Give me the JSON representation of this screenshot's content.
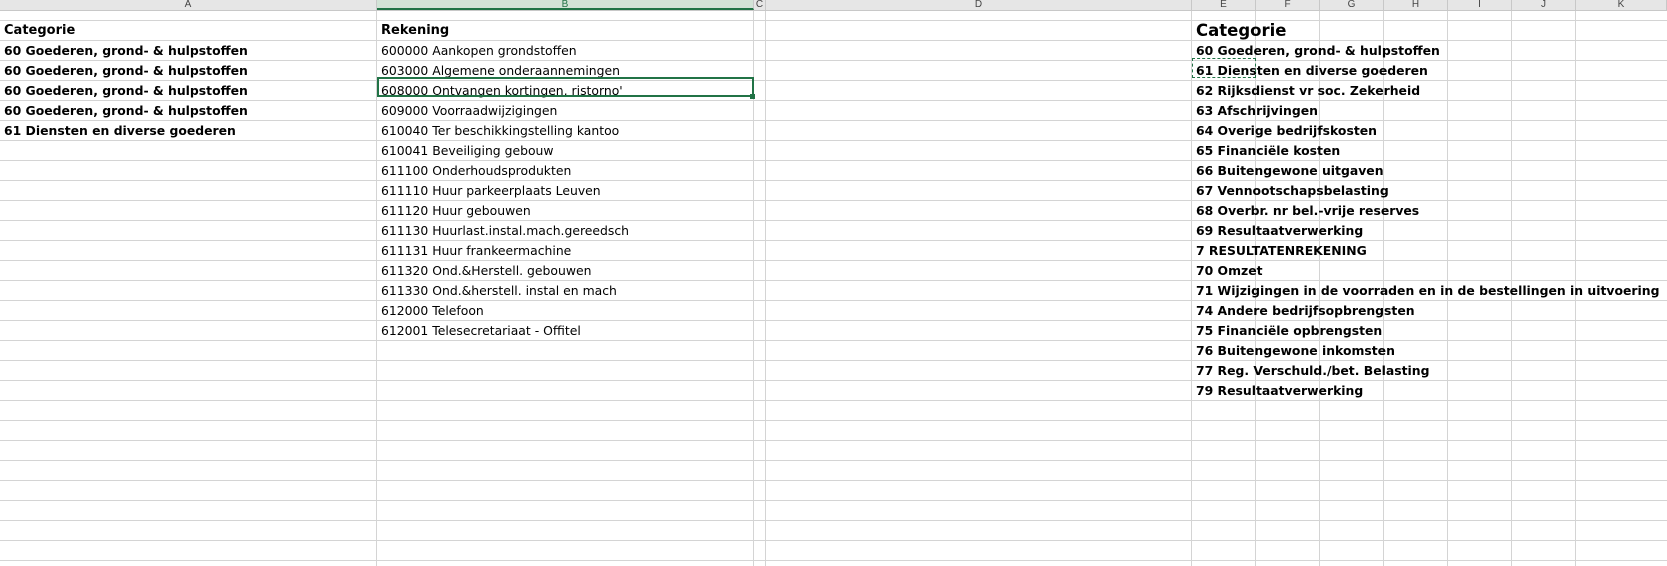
{
  "columns": [
    "A",
    "B",
    "C",
    "D",
    "E",
    "F",
    "G",
    "H",
    "I",
    "J",
    "K"
  ],
  "selected_column": "B",
  "sheet": {
    "a_header": "Categorie",
    "a_rows": [
      "60 Goederen, grond- & hulpstoffen",
      "60 Goederen, grond- & hulpstoffen",
      "60 Goederen, grond- & hulpstoffen",
      "60 Goederen, grond- & hulpstoffen",
      "61 Diensten en diverse goederen"
    ],
    "b_header": "Rekening",
    "b_rows": [
      "600000 Aankopen grondstoffen",
      "603000 Algemene onderaannemingen",
      "608000 Ontvangen kortingen, ristorno'",
      "609000 Voorraadwijzigingen",
      "610040 Ter beschikkingstelling kantoo",
      "610041 Beveiliging gebouw",
      "611100 Onderhoudsprodukten",
      "611110 Huur parkeerplaats Leuven",
      "611120 Huur gebouwen",
      "611130 Huurlast.instal.mach.gereedsch",
      "611131 Huur frankeermachine",
      "611320 Ond.&Herstell. gebouwen",
      "611330 Ond.&herstell. instal en mach",
      "612000 Telefoon",
      "612001 Telesecretariaat - Offitel"
    ],
    "e_header": "Categorie",
    "e_rows": [
      "60 Goederen, grond- & hulpstoffen",
      "61 Diensten en diverse goederen",
      "62 Rijksdienst vr soc. Zekerheid",
      "63 Afschrijvingen",
      "64 Overige bedrijfskosten",
      "65 Financiële kosten",
      "66 Buitengewone uitgaven",
      "67 Vennootschapsbelasting",
      "68 Overbr. nr bel.-vrije reserves",
      "69 Resultaatverwerking",
      "7 RESULTATENREKENING",
      "70 Omzet",
      "71 Wijzigingen in de voorraden en in de bestellingen in uitvoering",
      "74 Andere bedrijfsopbrengsten",
      "75 Financiële opbrengsten",
      "76 Buitengewone inkomsten",
      "77 Reg. Verschuld./bet. Belasting",
      "79 Resultaatverwerking"
    ]
  },
  "colors": {
    "accent": "#217346",
    "gridline": "#d4d4d4",
    "header_bg": "#e6e6e6"
  }
}
